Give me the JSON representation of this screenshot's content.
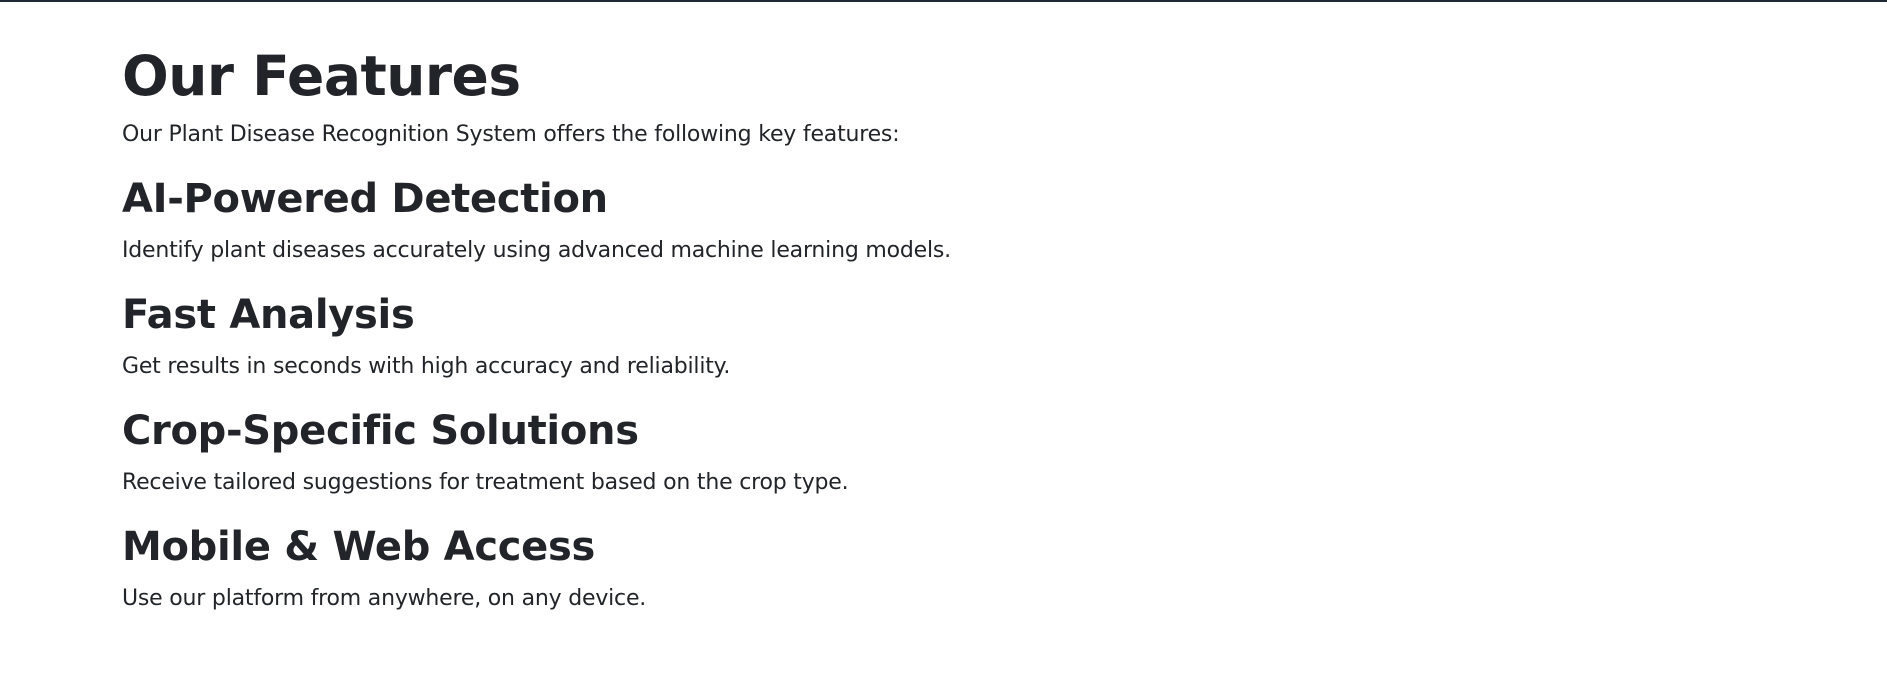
{
  "section": {
    "title": "Our Features",
    "intro": "Our Plant Disease Recognition System offers the following key features:"
  },
  "features": [
    {
      "title": "AI-Powered Detection",
      "description": "Identify plant diseases accurately using advanced machine learning models."
    },
    {
      "title": "Fast Analysis",
      "description": "Get results in seconds with high accuracy and reliability."
    },
    {
      "title": "Crop-Specific Solutions",
      "description": "Receive tailored suggestions for treatment based on the crop type."
    },
    {
      "title": "Mobile & Web Access",
      "description": "Use our platform from anywhere, on any device."
    }
  ],
  "colors": {
    "text": "#212529",
    "background": "#ffffff",
    "top_bar": "#1f2a36"
  }
}
